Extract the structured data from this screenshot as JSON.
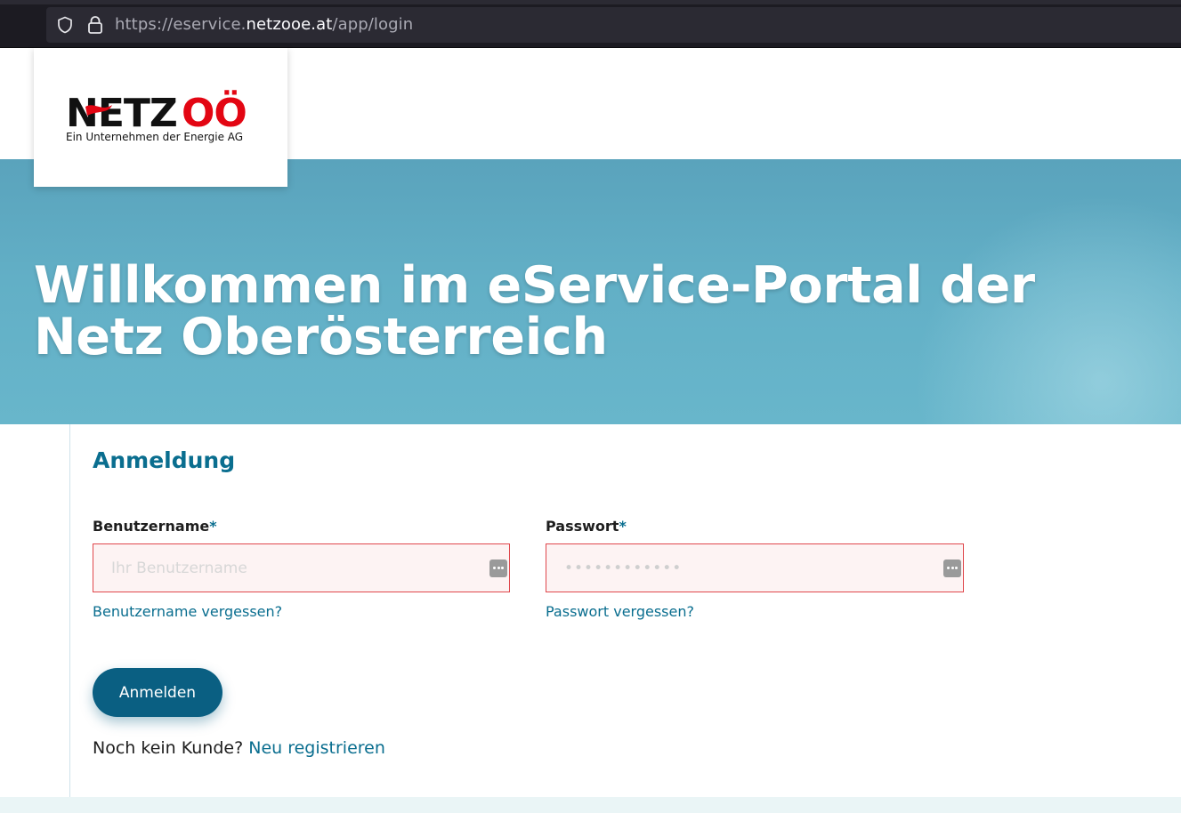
{
  "browser": {
    "url_prefix": "https://eservice.",
    "url_domain": "netzooe.at",
    "url_path": "/app/login"
  },
  "logo": {
    "brand_part1": "NETZ",
    "brand_part2": "OÖ",
    "tagline": "Ein Unternehmen der Energie AG",
    "colors": {
      "dark": "#111111",
      "red": "#e30613"
    }
  },
  "hero": {
    "title": "Willkommen im eService-Portal der Netz Oberösterreich"
  },
  "login": {
    "heading": "Anmeldung",
    "username": {
      "label": "Benutzername",
      "required_marker": "*",
      "placeholder": "Ihr Benutzername",
      "value": "",
      "forgot_link": "Benutzername vergessen?",
      "icon": "password-manager-icon"
    },
    "password": {
      "label": "Passwort",
      "required_marker": "*",
      "placeholder": "••••••••••••",
      "value": "",
      "forgot_link": "Passwort vergessen?",
      "icon": "password-manager-icon"
    },
    "submit_label": "Anmelden",
    "register_prompt": "Noch kein Kunde?",
    "register_link": "Neu registrieren"
  },
  "colors": {
    "accent": "#0a6e8f",
    "button": "#0a5f82",
    "error_border": "#e0474c",
    "error_fill": "#fdf3f3",
    "hero": "#62afc6"
  }
}
